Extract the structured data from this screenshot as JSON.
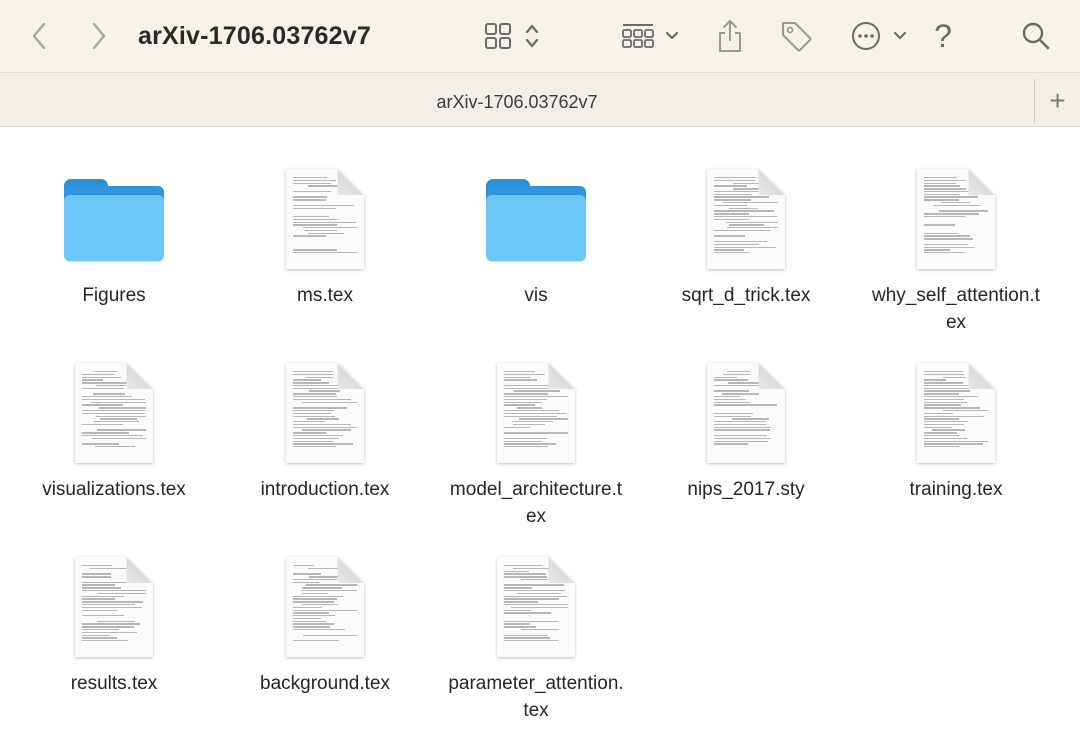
{
  "window": {
    "title": "arXiv-1706.03762v7",
    "tab_title": "arXiv-1706.03762v7"
  },
  "toolbar": {
    "back_icon": "chevron-left-icon",
    "forward_icon": "chevron-right-icon",
    "view_icon": "grid-view-icon",
    "group_icon": "group-by-icon",
    "share_icon": "share-icon",
    "tag_icon": "tag-icon",
    "more_icon": "more-options-icon",
    "help_label": "?",
    "search_icon": "search-icon"
  },
  "tabbar": {
    "add_label": "+"
  },
  "colors": {
    "folder_front": "#6cc6f8",
    "folder_back": "#2f93dd",
    "toolbar_bg": "#f6f2ea"
  },
  "files": [
    {
      "name": "Figures",
      "kind": "folder"
    },
    {
      "name": "ms.tex",
      "kind": "document"
    },
    {
      "name": "vis",
      "kind": "folder"
    },
    {
      "name": "sqrt_d_trick.tex",
      "kind": "document"
    },
    {
      "name": "why_self_attention.tex",
      "kind": "document"
    },
    {
      "name": "visualizations.tex",
      "kind": "document"
    },
    {
      "name": "introduction.tex",
      "kind": "document"
    },
    {
      "name": "model_architecture.tex",
      "kind": "document"
    },
    {
      "name": "nips_2017.sty",
      "kind": "document"
    },
    {
      "name": "training.tex",
      "kind": "document"
    },
    {
      "name": "results.tex",
      "kind": "document"
    },
    {
      "name": "background.tex",
      "kind": "document"
    },
    {
      "name": "parameter_attention.tex",
      "kind": "document"
    }
  ]
}
